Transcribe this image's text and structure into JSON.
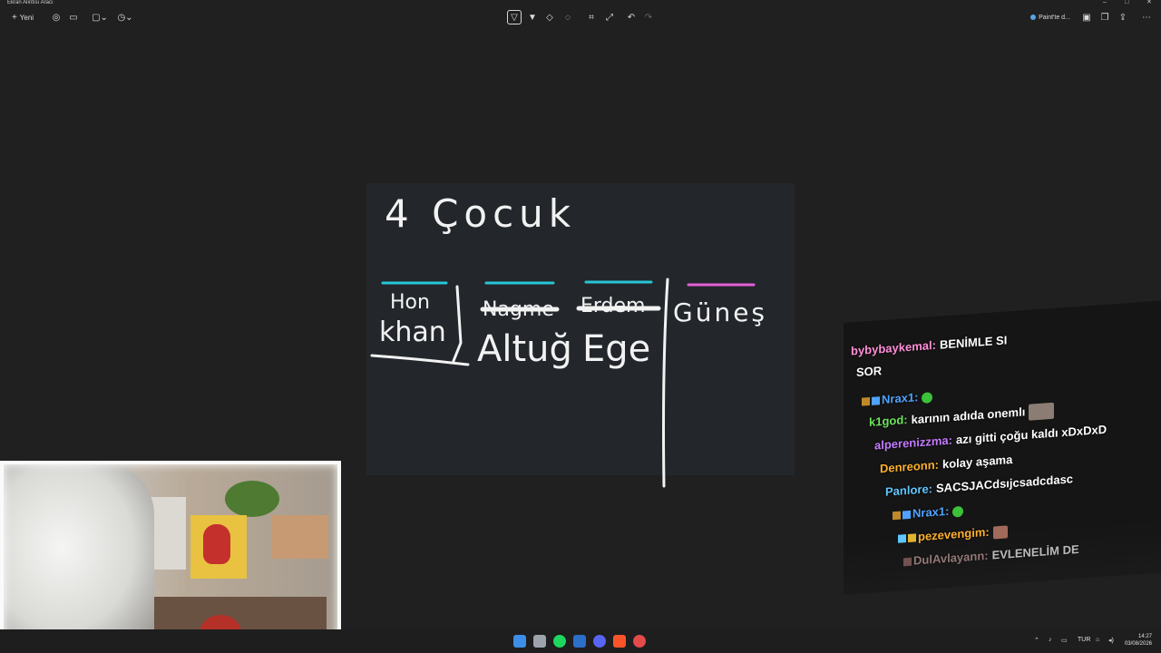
{
  "window": {
    "title": "Ekran Alıntısı Aracı"
  },
  "toolbar": {
    "new_label": "Yeni",
    "paint_label": "Paint'te d..."
  },
  "whiteboard": {
    "heading": "4 Çocuk",
    "names": [
      "Hon khan",
      "Altuğ",
      "Ege",
      "Güneş"
    ],
    "crossed": [
      "Nagme",
      "Erdem"
    ]
  },
  "chat": {
    "messages": [
      {
        "user": "bybybaykemal:",
        "text": "BENİMLE SI",
        "color": "#ff8fd8"
      },
      {
        "user": "",
        "text": "SOR",
        "color": "#ffffff"
      },
      {
        "user": "Nrax1:",
        "text": "",
        "color": "#4fa3ff"
      },
      {
        "user": "k1god:",
        "text": "karının adıda onemlı",
        "color": "#6de35b"
      },
      {
        "user": "alperenizzma:",
        "text": "azı gitti çoğu kaldı xDxDxD",
        "color": "#c47bff"
      },
      {
        "user": "Denreonn:",
        "text": "kolay aşama",
        "color": "#ffb12e"
      },
      {
        "user": "Panlore:",
        "text": "SACSJACdsıjcsadcdasc",
        "color": "#5ec7ff"
      },
      {
        "user": "Nrax1:",
        "text": "",
        "color": "#4fa3ff"
      },
      {
        "user": "pezevengim:",
        "text": "",
        "color": "#ffb12e"
      },
      {
        "user": "DulAvlayann:",
        "text": "EVLENELİM DE",
        "color": "#c9a0a0"
      }
    ]
  },
  "taskbar": {
    "lang": "TUR",
    "time": "14:27",
    "date": "03/08/2026"
  }
}
